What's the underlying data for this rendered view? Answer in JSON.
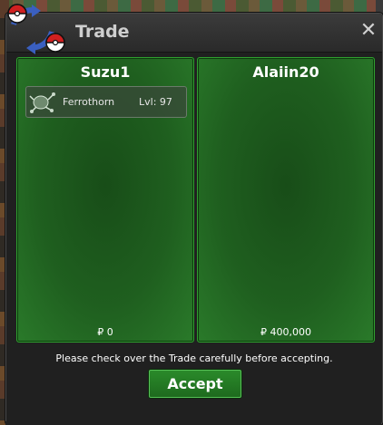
{
  "window": {
    "title": "Trade",
    "close_glyph": "✕",
    "logo_icon": "swap-pokeballs-icon"
  },
  "panels": {
    "left": {
      "player": "Suzu1",
      "items": [
        {
          "name": "Ferrothorn",
          "level": "Lvl: 97",
          "icon": "ferrothorn-sprite"
        }
      ],
      "money": "₽ 0"
    },
    "right": {
      "player": "Alaiin20",
      "items": [],
      "money": "₽ 400,000"
    }
  },
  "footer": {
    "note": "Please check over the Trade carefully before accepting.",
    "accept_label": "Accept"
  },
  "colors": {
    "panel_green": "#1f5f1f",
    "panel_border": "#2fa02f",
    "accept_green": "#2a8a2a",
    "titlebar": "#2a2a2a"
  }
}
